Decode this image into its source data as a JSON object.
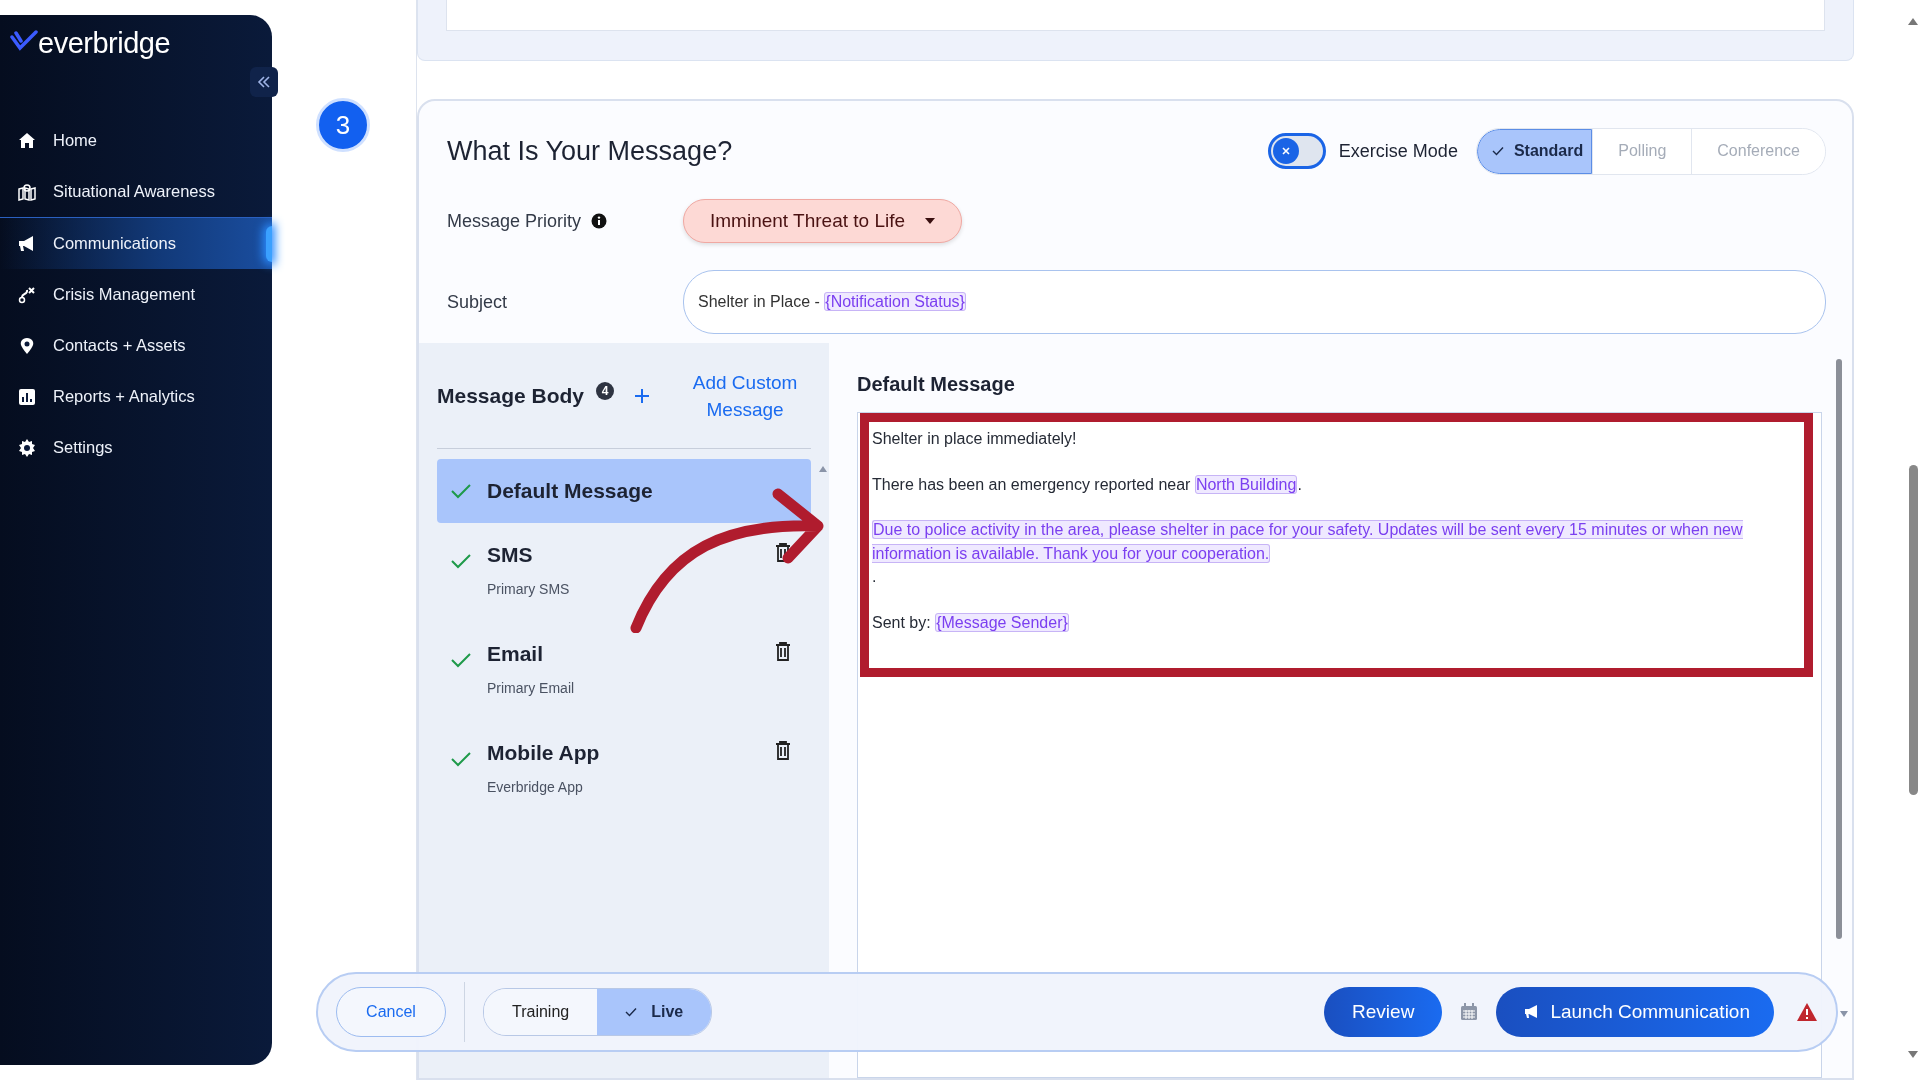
{
  "sidebar": {
    "logo": "everbridge",
    "items": [
      {
        "label": "Home",
        "selected": false
      },
      {
        "label": "Situational Awareness",
        "selected": false
      },
      {
        "label": "Communications",
        "selected": true
      },
      {
        "label": "Crisis Management",
        "selected": false
      },
      {
        "label": "Contacts + Assets",
        "selected": false
      },
      {
        "label": "Reports + Analytics",
        "selected": false
      },
      {
        "label": "Settings",
        "selected": false
      }
    ]
  },
  "step": {
    "number": "3"
  },
  "message_card": {
    "title": "What Is Your Message?",
    "exercise_mode": {
      "label": "Exercise Mode",
      "on": false
    },
    "modes": [
      {
        "label": "Standard",
        "selected": true
      },
      {
        "label": "Polling",
        "selected": false
      },
      {
        "label": "Conference",
        "selected": false
      }
    ],
    "priority": {
      "label": "Message Priority",
      "value": "Imminent Threat to Life"
    },
    "subject": {
      "label": "Subject",
      "parts": [
        {
          "kind": "plain",
          "text": "Shelter in Place - "
        },
        {
          "kind": "token",
          "text": "{Notification Status}"
        }
      ]
    },
    "message_body": {
      "title": "Message Body",
      "count": "4",
      "add_link": "Add Custom Message",
      "items": [
        {
          "title": "Default Message",
          "checked": true,
          "selected": true,
          "deletable": false
        },
        {
          "title": "SMS",
          "subtitle": "Primary SMS",
          "checked": true,
          "selected": false,
          "deletable": true
        },
        {
          "title": "Email",
          "subtitle": "Primary Email",
          "checked": true,
          "selected": false,
          "deletable": true
        },
        {
          "title": "Mobile App",
          "subtitle": "Everbridge App",
          "checked": true,
          "selected": false,
          "deletable": true
        }
      ]
    },
    "editor": {
      "title": "Default Message",
      "paragraphs": [
        {
          "spaced": false,
          "parts": [
            {
              "kind": "plain",
              "text": "Shelter in place immediately!"
            }
          ]
        },
        {
          "spaced": true,
          "parts": [
            {
              "kind": "plain",
              "text": "There has been an emergency reported near "
            },
            {
              "kind": "token",
              "text": "North Building"
            },
            {
              "kind": "plain",
              "text": "."
            }
          ]
        },
        {
          "spaced": true,
          "parts": [
            {
              "kind": "token",
              "text": "Due to police activity in the area, please shelter in pace for your safety. Updates will be sent every 15 minutes or when new information is available. Thank you for your cooperation."
            }
          ]
        },
        {
          "spaced": false,
          "parts": [
            {
              "kind": "plain",
              "text": "."
            }
          ]
        },
        {
          "spaced": true,
          "parts": [
            {
              "kind": "plain",
              "text": "Sent by: "
            },
            {
              "kind": "token",
              "text": "{Message Sender}"
            }
          ]
        }
      ]
    }
  },
  "footer": {
    "cancel": "Cancel",
    "modes": [
      {
        "label": "Training",
        "selected": false
      },
      {
        "label": "Live",
        "selected": true
      }
    ],
    "review": "Review",
    "launch": "Launch Communication"
  }
}
